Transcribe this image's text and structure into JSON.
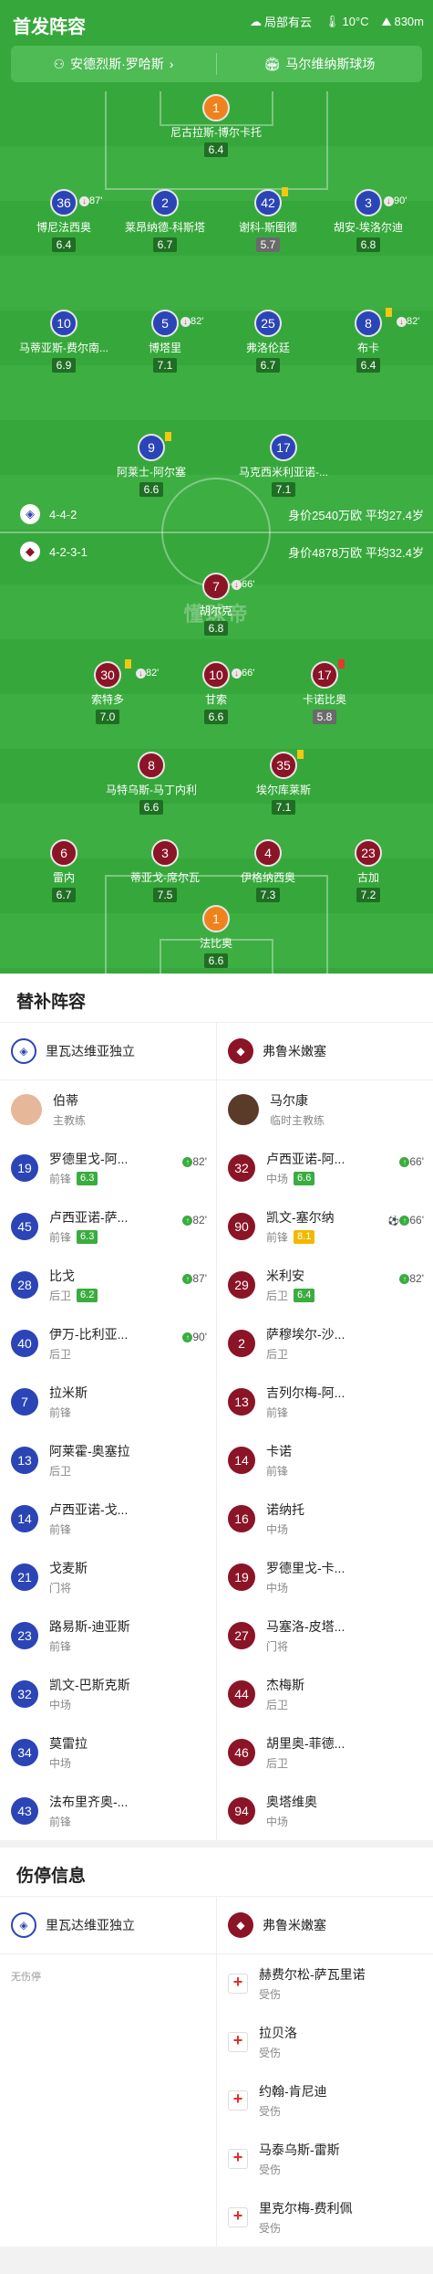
{
  "header": {
    "title": "首发阵容",
    "weather": "局部有云",
    "temperature": "10°C",
    "altitude": "830m",
    "referee": "安德烈斯·罗哈斯",
    "stadium": "马尔维纳斯球场"
  },
  "home": {
    "formation": "4-4-2",
    "stats": "身价2540万欧 平均27.4岁"
  },
  "away": {
    "formation": "4-2-3-1",
    "stats": "身价4878万欧 平均32.4岁"
  },
  "pitch_players": [
    {
      "num": "1",
      "name": "尼古拉斯-博尔卡托",
      "rating": "6.4",
      "color": "orange"
    },
    {
      "num": "36",
      "name": "博尼法西奥",
      "rating": "6.4",
      "color": "blue",
      "sub": "87'"
    },
    {
      "num": "2",
      "name": "莱昂纳德-科斯塔",
      "rating": "6.7",
      "color": "blue"
    },
    {
      "num": "42",
      "name": "谢科-斯图德",
      "rating": "5.7",
      "color": "blue",
      "sub": "",
      "card": "yellow"
    },
    {
      "num": "3",
      "name": "胡安-埃洛尔迪",
      "rating": "6.8",
      "color": "blue",
      "sub": "90'"
    },
    {
      "num": "10",
      "name": "马蒂亚斯-费尔南...",
      "rating": "6.9",
      "color": "blue"
    },
    {
      "num": "5",
      "name": "博塔里",
      "rating": "7.1",
      "color": "blue",
      "sub": "82'"
    },
    {
      "num": "25",
      "name": "弗洛伦廷",
      "rating": "6.7",
      "color": "blue"
    },
    {
      "num": "8",
      "name": "布卡",
      "rating": "6.4",
      "color": "blue",
      "sub": "82'",
      "card": "yellow"
    },
    {
      "num": "9",
      "name": "阿莱士-阿尔塞",
      "rating": "6.6",
      "color": "blue",
      "card": "yellow"
    },
    {
      "num": "17",
      "name": "马克西米利亚诺-...",
      "rating": "7.1",
      "color": "blue"
    },
    {
      "num": "7",
      "name": "胡尔克",
      "rating": "6.8",
      "color": "red",
      "sub": "66'"
    },
    {
      "num": "30",
      "name": "索特多",
      "rating": "7.0",
      "color": "red",
      "sub": "82'",
      "card": "yellow"
    },
    {
      "num": "10",
      "name": "甘索",
      "rating": "6.6",
      "color": "red",
      "sub": "66'"
    },
    {
      "num": "17",
      "name": "卡诺比奥",
      "rating": "5.8",
      "color": "red",
      "card": "red"
    },
    {
      "num": "8",
      "name": "马特乌斯-马丁内利",
      "rating": "6.6",
      "color": "red"
    },
    {
      "num": "35",
      "name": "埃尔库莱斯",
      "rating": "7.1",
      "color": "red",
      "card": "yellow"
    },
    {
      "num": "6",
      "name": "雷内",
      "rating": "6.7",
      "color": "red"
    },
    {
      "num": "3",
      "name": "蒂亚戈-席尔瓦",
      "rating": "7.5",
      "color": "red"
    },
    {
      "num": "4",
      "name": "伊格纳西奥",
      "rating": "7.3",
      "color": "red"
    },
    {
      "num": "23",
      "name": "古加",
      "rating": "7.2",
      "color": "red"
    },
    {
      "num": "1",
      "name": "法比奥",
      "rating": "6.6",
      "color": "orange"
    }
  ],
  "subs": {
    "title": "替补阵容",
    "home_team": "里瓦达维亚独立",
    "away_team": "弗鲁米嫩塞",
    "home_coach": {
      "name": "伯蒂",
      "role": "主教练"
    },
    "away_coach": {
      "name": "马尔康",
      "role": "临时主教练"
    },
    "home": [
      {
        "num": "19",
        "name": "罗德里戈-阿...",
        "pos": "前锋",
        "rating": "6.3",
        "min": "82'"
      },
      {
        "num": "45",
        "name": "卢西亚诺-萨...",
        "pos": "前锋",
        "rating": "6.3",
        "min": "82'"
      },
      {
        "num": "28",
        "name": "比戈",
        "pos": "后卫",
        "rating": "6.2",
        "min": "87'"
      },
      {
        "num": "40",
        "name": "伊万-比利亚...",
        "pos": "后卫",
        "rating": "",
        "min": "90'"
      },
      {
        "num": "7",
        "name": "拉米斯",
        "pos": "前锋"
      },
      {
        "num": "13",
        "name": "阿莱霍-奥塞拉",
        "pos": "后卫"
      },
      {
        "num": "14",
        "name": "卢西亚诺-戈...",
        "pos": "前锋"
      },
      {
        "num": "21",
        "name": "戈麦斯",
        "pos": "门将"
      },
      {
        "num": "23",
        "name": "路易斯-迪亚斯",
        "pos": "前锋"
      },
      {
        "num": "32",
        "name": "凯文-巴斯克斯",
        "pos": "中场"
      },
      {
        "num": "34",
        "name": "莫雷拉",
        "pos": "中场"
      },
      {
        "num": "43",
        "name": "法布里齐奥-...",
        "pos": "前锋"
      }
    ],
    "away": [
      {
        "num": "32",
        "name": "卢西亚诺-阿...",
        "pos": "中场",
        "rating": "6.6",
        "min": "66'"
      },
      {
        "num": "90",
        "name": "凯文-塞尔纳",
        "pos": "前锋",
        "rating": "8.1",
        "min": "66'",
        "yellow": true
      },
      {
        "num": "29",
        "name": "米利安",
        "pos": "后卫",
        "rating": "6.4",
        "min": "82'"
      },
      {
        "num": "2",
        "name": "萨穆埃尔-沙...",
        "pos": "后卫"
      },
      {
        "num": "13",
        "name": "吉列尔梅-阿...",
        "pos": "前锋"
      },
      {
        "num": "14",
        "name": "卡诺",
        "pos": "前锋"
      },
      {
        "num": "16",
        "name": "诺纳托",
        "pos": "中场"
      },
      {
        "num": "19",
        "name": "罗德里戈-卡...",
        "pos": "中场"
      },
      {
        "num": "27",
        "name": "马塞洛-皮塔...",
        "pos": "门将"
      },
      {
        "num": "44",
        "name": "杰梅斯",
        "pos": "后卫"
      },
      {
        "num": "46",
        "name": "胡里奥-菲德...",
        "pos": "后卫"
      },
      {
        "num": "94",
        "name": "奥塔维奥",
        "pos": "中场"
      }
    ]
  },
  "injuries": {
    "title": "伤停信息",
    "home_empty": "无伤停",
    "away": [
      {
        "name": "赫费尔松-萨瓦里诺",
        "status": "受伤"
      },
      {
        "name": "拉贝洛",
        "status": "受伤"
      },
      {
        "name": "约翰-肯尼迪",
        "status": "受伤"
      },
      {
        "name": "马泰乌斯-雷斯",
        "status": "受伤"
      },
      {
        "name": "里克尔梅-费利佩",
        "status": "受伤"
      }
    ]
  },
  "watermark": "懂球帝",
  "colors": {
    "home": "#2b45b6",
    "away": "#8b1427",
    "gk": "#f0821e",
    "pitch": "#36a83b"
  }
}
